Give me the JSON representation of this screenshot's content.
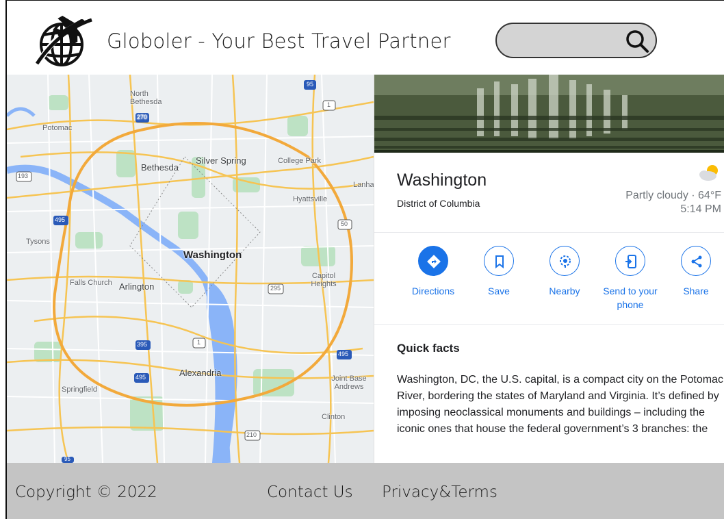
{
  "header": {
    "site_title": "Globoler - Your Best Travel Partner",
    "search_placeholder": ""
  },
  "map": {
    "labels": {
      "north_bethesda": "North Bethesda",
      "potomac": "Potomac",
      "bethesda": "Bethesda",
      "silver_spring": "Silver Spring",
      "college_park": "College Park",
      "lanham": "Lanha",
      "hyattsville": "Hyattsville",
      "tysons": "Tysons",
      "washington": "Washington",
      "falls_church": "Falls Church",
      "arlington": "Arlington",
      "capitol_heights": "Capitol Heights",
      "alexandria": "Alexandria",
      "joint_base_andrews": "Joint Base Andrews",
      "springfield": "Springfield",
      "clinton": "Clinton"
    },
    "shields": {
      "i270": "270",
      "i95_top": "95",
      "us1_top": "1",
      "r193": "193",
      "i495_left": "495",
      "r50": "50",
      "r295": "295",
      "i395": "395",
      "us1_mid": "1",
      "i495_right": "495",
      "i495_bottom": "495",
      "r210": "210",
      "i95_bottom": "95"
    }
  },
  "panel": {
    "place_name": "Washington",
    "place_subtitle": "District of Columbia",
    "weather": "Partly cloudy · 64°F",
    "time": "5:14 PM",
    "actions": {
      "directions": "Directions",
      "save": "Save",
      "nearby": "Nearby",
      "send_line1": "Send to your",
      "send_line2": "phone",
      "share": "Share"
    },
    "quick_facts_title": "Quick facts",
    "quick_facts_body": "Washington, DC, the U.S. capital, is a compact city on the Potomac River, bordering the states of Maryland and Virginia. It’s defined by imposing neoclassical monuments and buildings – including the iconic ones that house the federal government’s 3 branches: the"
  },
  "footer": {
    "copyright": "Copyright © 2022",
    "contact": "Contact Us",
    "privacy": "Privacy&Terms"
  },
  "colors": {
    "accent": "#1a73e8",
    "footer_bg": "#c4c4c4",
    "search_bg": "#d4d4d4",
    "map_bg": "#eceff1",
    "road": "#f6c453",
    "water": "#8ab4f8",
    "park": "#bde2c4"
  }
}
